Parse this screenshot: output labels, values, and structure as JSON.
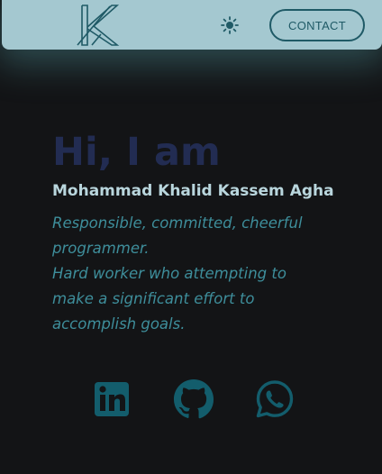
{
  "colors": {
    "nav_background": "#a4c8d0",
    "page_background": "#131416",
    "accent": "#1f5a66",
    "greeting": "#222c52",
    "name": "#b9d6dd",
    "tagline": "#3e8e9b",
    "social_icon": "#135d6c"
  },
  "navbar": {
    "logo_icon": "k-monogram-icon",
    "theme_toggle_icon": "sun-icon",
    "contact_label": "CONTACT"
  },
  "hero": {
    "greeting": "Hi, I am",
    "name": "Mohammad Khalid Kassem Agha",
    "tagline_line1": "Responsible, committed, cheerful programmer.",
    "tagline_line2": "Hard worker who attempting to make a significant effort to accomplish goals."
  },
  "social": {
    "icons": [
      "linkedin-icon",
      "github-icon",
      "whatsapp-icon"
    ]
  }
}
